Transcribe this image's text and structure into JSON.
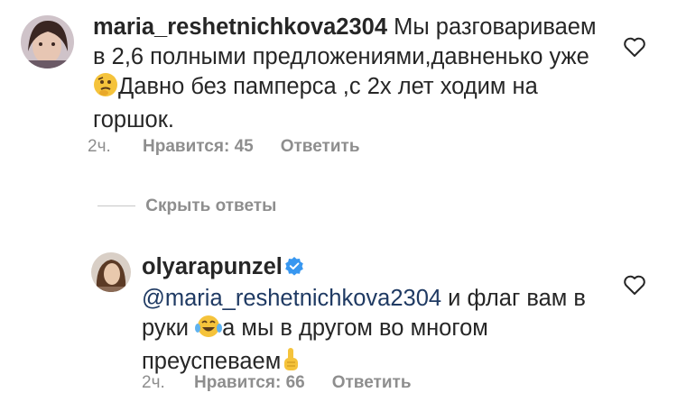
{
  "comments": [
    {
      "username": "maria_reshetnichkova2304",
      "text_part1": " Мы разговариваем в 2,6 полными предложениями,давненько уже",
      "emoji1": "thinking-face",
      "text_part2": "Давно без памперса ,с 2х лет ходим на горшок.",
      "time": "2ч.",
      "likes": "Нравится: 45",
      "reply": "Ответить"
    },
    {
      "username": "olyarapunzel",
      "verified": true,
      "mention": "@maria_reshetnichkova2304",
      "text_part1": " и флаг вам в руки ",
      "emoji1": "face-with-tears-of-joy",
      "text_part2": "а мы в другом во многом преуспеваем",
      "emoji2": "index-pointing-up",
      "time": "2ч.",
      "likes": "Нравится: 66",
      "reply": "Ответить"
    }
  ],
  "hide_replies": "Скрыть ответы",
  "colors": {
    "text": "#262626",
    "meta": "#8e8e8e",
    "mention": "#1f3a63",
    "verified": "#3897f0"
  }
}
